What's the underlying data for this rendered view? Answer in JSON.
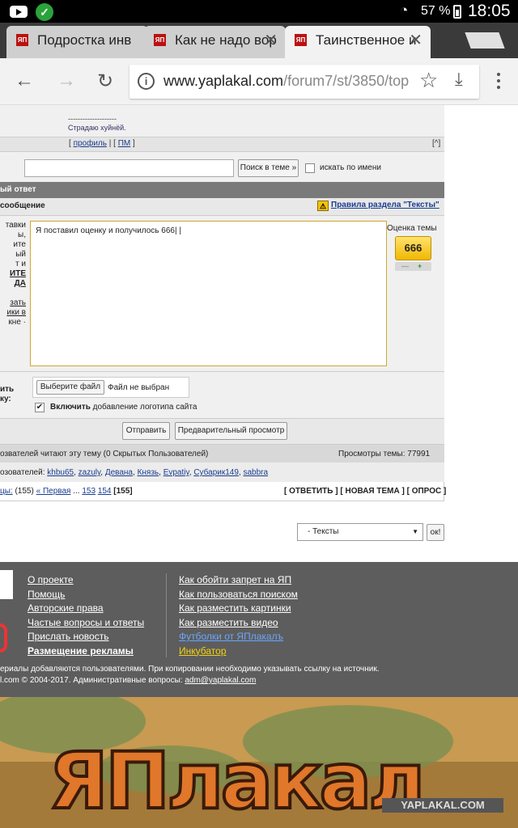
{
  "status_bar": {
    "battery": "57 %",
    "time": "18:05"
  },
  "tabs": [
    {
      "title": "Подростка инв"
    },
    {
      "title": "Как не надо вор"
    },
    {
      "title": "Таинственное и"
    }
  ],
  "address_bar": {
    "host": "www.yaplakal.com",
    "path": "/forum7/st/3850/top"
  },
  "post": {
    "signature_dashes": "--------------------",
    "signature": "Страдаю хуйнёй.",
    "links": {
      "profile": "профиль",
      "pm": "ПМ",
      "top": "[^]"
    }
  },
  "search": {
    "button": "Поиск в теме »",
    "by_name": "искать по имени"
  },
  "fast_reply": {
    "title": "ый ответ"
  },
  "message": {
    "header": "сообщение",
    "rules_link": "Правила раздела \"Тексты\"",
    "text": "Я поставил оценку и получилось 666",
    "left_hint": [
      "тавки",
      "ы,",
      "ите",
      "ый",
      "т и",
      "ИТЕ",
      "ДА",
      "",
      "зать",
      "ики в",
      "кне ·"
    ]
  },
  "rating": {
    "label": "Оценка темы",
    "value": "666",
    "minus": "—",
    "plus": "+"
  },
  "attach": {
    "left_label": [
      "ить",
      "ку:"
    ],
    "choose_button": "Выберите файл",
    "no_file": "Файл не выбран",
    "logo_bold": "Включить",
    "logo_rest": " добавление логотипа сайта"
  },
  "actions": {
    "submit": "Отправить",
    "preview": "Предварительный просмотр"
  },
  "readers": {
    "text": "озвателей читают эту тему (0 Скрытых Пользователей)",
    "views": "Просмотры темы: 77991"
  },
  "users": {
    "prefix": "озователей: ",
    "list": [
      "khbu65",
      "zazuly",
      "Девана",
      "Князь",
      "Evpatiy",
      "Субарик149",
      "sabbra"
    ]
  },
  "pagination": {
    "prefix": "цы:",
    "count": " (155) ",
    "first": "« Первая",
    "dots": " ... ",
    "p1": "153",
    "p2": "154",
    "current": "[155]",
    "actions": "[ ОТВЕТИТЬ ] [ НОВАЯ ТЕМА ] [ ОПРОС ]"
  },
  "forum_select": {
    "value": "- Тексты",
    "ok": "ок!"
  },
  "footer": {
    "col1": [
      "О проекте",
      "Помощь",
      "Авторские права",
      "Частые вопросы и ответы",
      "Прислать новость",
      "Размещение рекламы"
    ],
    "col2": [
      "Как обойти запрет на ЯП",
      "Как пользоваться поиском",
      "Как разместить картинки",
      "Как разместить видео",
      "Футболки от ЯПлакалъ",
      "Инкубатор"
    ],
    "note": "ериалы добавляются пользователями. При копировании необходимо указывать ссылку на источник.",
    "copyright": "l.com © 2004-2017. Административные вопросы: ",
    "email": "adm@yaplakal.com"
  },
  "banner": {
    "letters": "ЯПлакал",
    "watermark": "YAPLAKAL.COM"
  }
}
